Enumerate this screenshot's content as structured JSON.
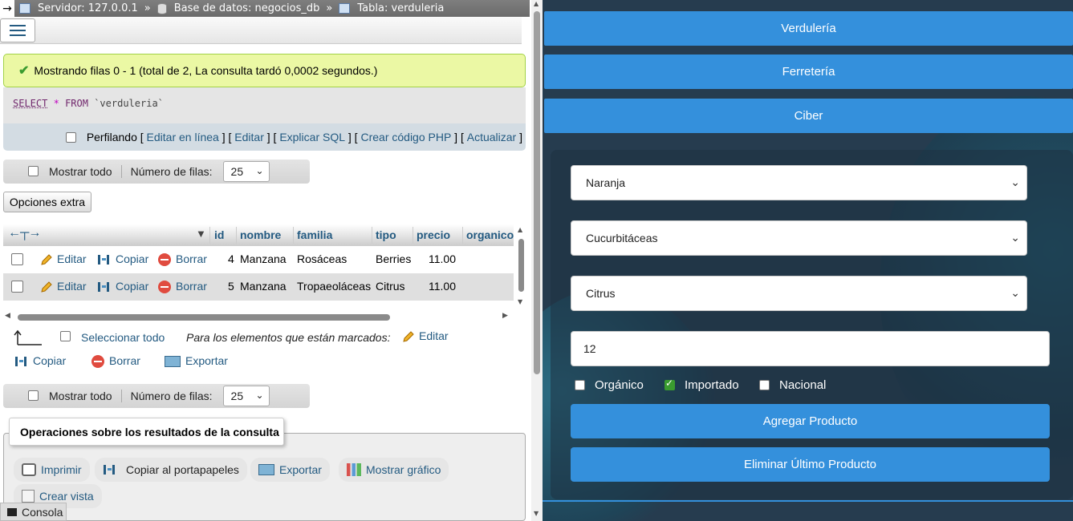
{
  "breadcrumb": {
    "back_arrow": "→",
    "server": "Servidor: 127.0.0.1",
    "database": "Base de datos: negocios_db",
    "table": "Tabla: verduleria",
    "separator": "»"
  },
  "success_message": "Mostrando filas 0 - 1 (total de 2, La consulta tardó 0,0002 segundos.)",
  "sql": {
    "select": "SELECT",
    "star": "*",
    "from": "FROM",
    "table": "`verduleria`"
  },
  "profiling": {
    "label": "Perfilando",
    "links": [
      "Editar en línea",
      "Editar",
      "Explicar SQL",
      "Crear código PHP",
      "Actualizar"
    ]
  },
  "nav": {
    "show_all": "Mostrar todo",
    "rows_label": "Número de filas:",
    "rows_value": "25"
  },
  "extra_options": "Opciones extra",
  "table": {
    "columns": [
      "id",
      "nombre",
      "familia",
      "tipo",
      "precio",
      "organico"
    ],
    "rows": [
      {
        "id": "4",
        "nombre": "Manzana",
        "familia": "Rosáceas",
        "tipo": "Berries",
        "precio": "11.00"
      },
      {
        "id": "5",
        "nombre": "Manzana",
        "familia": "Tropaeoláceas",
        "tipo": "Citrus",
        "precio": "11.00"
      }
    ],
    "actions": {
      "edit": "Editar",
      "copy": "Copiar",
      "delete": "Borrar"
    }
  },
  "bulk": {
    "select_all": "Seleccionar todo",
    "for_marked": "Para los elementos que están marcados:",
    "edit": "Editar",
    "copy": "Copiar",
    "delete": "Borrar",
    "export": "Exportar"
  },
  "operations": {
    "legend": "Operaciones sobre los resultados de la consulta",
    "print": "Imprimir",
    "copy_clipboard": "Copiar al portapapeles",
    "export": "Exportar",
    "chart": "Mostrar gráfico",
    "create_view": "Crear vista"
  },
  "console": "Consola",
  "app": {
    "nav": [
      "Verdulería",
      "Ferretería",
      "Ciber"
    ],
    "select_product": "Naranja",
    "select_family": "Cucurbitáceas",
    "select_type": "Citrus",
    "price_value": "12",
    "checkboxes": [
      {
        "label": "Orgánico",
        "checked": false
      },
      {
        "label": "Importado",
        "checked": true
      },
      {
        "label": "Nacional",
        "checked": false
      }
    ],
    "add_button": "Agregar Producto",
    "remove_button": "Eliminar Último Producto"
  },
  "colors": {
    "app_accent": "#3490dc",
    "app_background": "#263c4f",
    "pma_link": "#235a81",
    "success_bg": "#ebf8a4"
  }
}
